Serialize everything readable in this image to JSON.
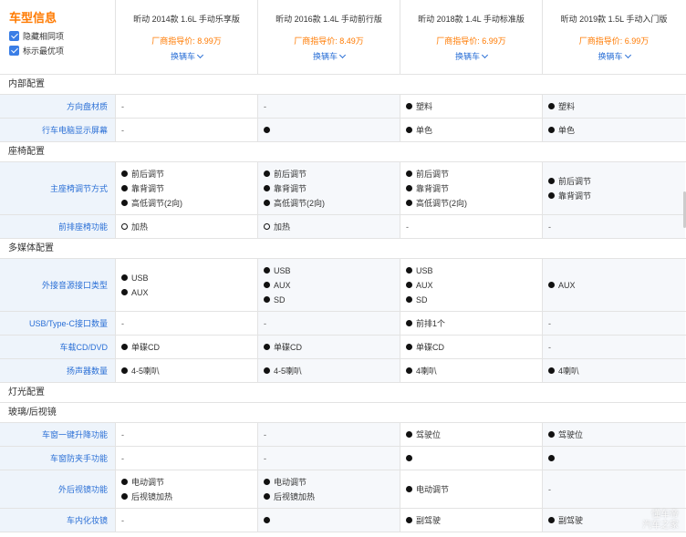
{
  "brand": {
    "title": "车型信息",
    "options": [
      {
        "label": "隐藏相同项",
        "checked": true
      },
      {
        "label": "标示最优项",
        "checked": true
      }
    ]
  },
  "cars": [
    {
      "name": "昕动 2014款 1.6L 手动乐享版",
      "price": "厂商指导价: 8.99万",
      "switch": "换辆车"
    },
    {
      "name": "昕动 2016款 1.4L 手动前行版",
      "price": "厂商指导价: 8.49万",
      "switch": "换辆车"
    },
    {
      "name": "昕动 2018款 1.4L 手动标准版",
      "price": "厂商指导价: 6.99万",
      "switch": "换辆车"
    },
    {
      "name": "昕动 2019款 1.5L 手动入门版",
      "price": "厂商指导价: 6.99万",
      "switch": "换辆车"
    }
  ],
  "sections": [
    {
      "title": "内部配置",
      "rows": [
        {
          "label": "方向盘材质",
          "h": 26,
          "cells": [
            [
              {
                "m": "-",
                "t": ""
              }
            ],
            [
              {
                "m": "-",
                "t": ""
              }
            ],
            [
              {
                "m": "dot",
                "t": "塑料"
              }
            ],
            [
              {
                "m": "dot",
                "t": "塑料"
              }
            ]
          ]
        },
        {
          "label": "行车电脑显示屏幕",
          "h": 26,
          "cells": [
            [
              {
                "m": "-",
                "t": ""
              }
            ],
            [
              {
                "m": "dot",
                "t": ""
              }
            ],
            [
              {
                "m": "dot",
                "t": "单色"
              }
            ],
            [
              {
                "m": "dot",
                "t": "单色"
              }
            ]
          ]
        }
      ]
    },
    {
      "title": "座椅配置",
      "rows": [
        {
          "label": "主座椅调节方式",
          "h": 58,
          "cells": [
            [
              {
                "m": "dot",
                "t": "前后调节"
              },
              {
                "m": "dot",
                "t": "靠背调节"
              },
              {
                "m": "dot",
                "t": "高低调节(2向)"
              }
            ],
            [
              {
                "m": "dot",
                "t": "前后调节"
              },
              {
                "m": "dot",
                "t": "靠背调节"
              },
              {
                "m": "dot",
                "t": "高低调节(2向)"
              }
            ],
            [
              {
                "m": "dot",
                "t": "前后调节"
              },
              {
                "m": "dot",
                "t": "靠背调节"
              },
              {
                "m": "dot",
                "t": "高低调节(2向)"
              }
            ],
            [
              {
                "m": "dot",
                "t": "前后调节"
              },
              {
                "m": "dot",
                "t": "靠背调节"
              }
            ]
          ]
        },
        {
          "label": "前排座椅功能",
          "h": 26,
          "cells": [
            [
              {
                "m": "ring",
                "t": "加热"
              }
            ],
            [
              {
                "m": "ring",
                "t": "加热"
              }
            ],
            [
              {
                "m": "-",
                "t": ""
              }
            ],
            [
              {
                "m": "-",
                "t": ""
              }
            ]
          ]
        }
      ]
    },
    {
      "title": "多媒体配置",
      "rows": [
        {
          "label": "外接音源接口类型",
          "h": 58,
          "cells": [
            [
              {
                "m": "dot",
                "t": "USB"
              },
              {
                "m": "dot",
                "t": "AUX"
              }
            ],
            [
              {
                "m": "dot",
                "t": "USB"
              },
              {
                "m": "dot",
                "t": "AUX"
              },
              {
                "m": "dot",
                "t": "SD"
              }
            ],
            [
              {
                "m": "dot",
                "t": "USB"
              },
              {
                "m": "dot",
                "t": "AUX"
              },
              {
                "m": "dot",
                "t": "SD"
              }
            ],
            [
              {
                "m": "dot",
                "t": "AUX"
              }
            ]
          ]
        },
        {
          "label": "USB/Type-C接口数量",
          "h": 26,
          "cells": [
            [
              {
                "m": "-",
                "t": ""
              }
            ],
            [
              {
                "m": "-",
                "t": ""
              }
            ],
            [
              {
                "m": "dot",
                "t": "前排1个"
              }
            ],
            [
              {
                "m": "-",
                "t": ""
              }
            ]
          ]
        },
        {
          "label": "车载CD/DVD",
          "h": 26,
          "cells": [
            [
              {
                "m": "dot",
                "t": "单碟CD"
              }
            ],
            [
              {
                "m": "dot",
                "t": "单碟CD"
              }
            ],
            [
              {
                "m": "dot",
                "t": "单碟CD"
              }
            ],
            [
              {
                "m": "-",
                "t": ""
              }
            ]
          ]
        },
        {
          "label": "扬声器数量",
          "h": 26,
          "cells": [
            [
              {
                "m": "dot",
                "t": "4-5喇叭"
              }
            ],
            [
              {
                "m": "dot",
                "t": "4-5喇叭"
              }
            ],
            [
              {
                "m": "dot",
                "t": "4喇叭"
              }
            ],
            [
              {
                "m": "dot",
                "t": "4喇叭"
              }
            ]
          ]
        }
      ]
    },
    {
      "title": "灯光配置",
      "rows": []
    },
    {
      "title": "玻璃/后视镜",
      "rows": [
        {
          "label": "车窗一键升降功能",
          "h": 26,
          "cells": [
            [
              {
                "m": "-",
                "t": ""
              }
            ],
            [
              {
                "m": "-",
                "t": ""
              }
            ],
            [
              {
                "m": "dot",
                "t": "驾驶位"
              }
            ],
            [
              {
                "m": "dot",
                "t": "驾驶位"
              }
            ]
          ]
        },
        {
          "label": "车窗防夹手功能",
          "h": 26,
          "cells": [
            [
              {
                "m": "-",
                "t": ""
              }
            ],
            [
              {
                "m": "-",
                "t": ""
              }
            ],
            [
              {
                "m": "dot",
                "t": ""
              }
            ],
            [
              {
                "m": "dot",
                "t": ""
              }
            ]
          ]
        },
        {
          "label": "外后视镜功能",
          "h": 42,
          "cells": [
            [
              {
                "m": "dot",
                "t": "电动调节"
              },
              {
                "m": "dot",
                "t": "后视镜加热"
              }
            ],
            [
              {
                "m": "dot",
                "t": "电动调节"
              },
              {
                "m": "dot",
                "t": "后视镜加热"
              }
            ],
            [
              {
                "m": "dot",
                "t": "电动调节"
              }
            ],
            [
              {
                "m": "-",
                "t": ""
              }
            ]
          ]
        },
        {
          "label": "车内化妆镜",
          "h": 26,
          "cells": [
            [
              {
                "m": "-",
                "t": ""
              }
            ],
            [
              {
                "m": "dot",
                "t": ""
              }
            ],
            [
              {
                "m": "dot",
                "t": "副驾驶"
              }
            ],
            [
              {
                "m": "dot",
                "t": "副驾驶"
              }
            ]
          ]
        }
      ]
    }
  ],
  "watermark": {
    "line1": "懂车帝",
    "line2": "汽车之家"
  }
}
